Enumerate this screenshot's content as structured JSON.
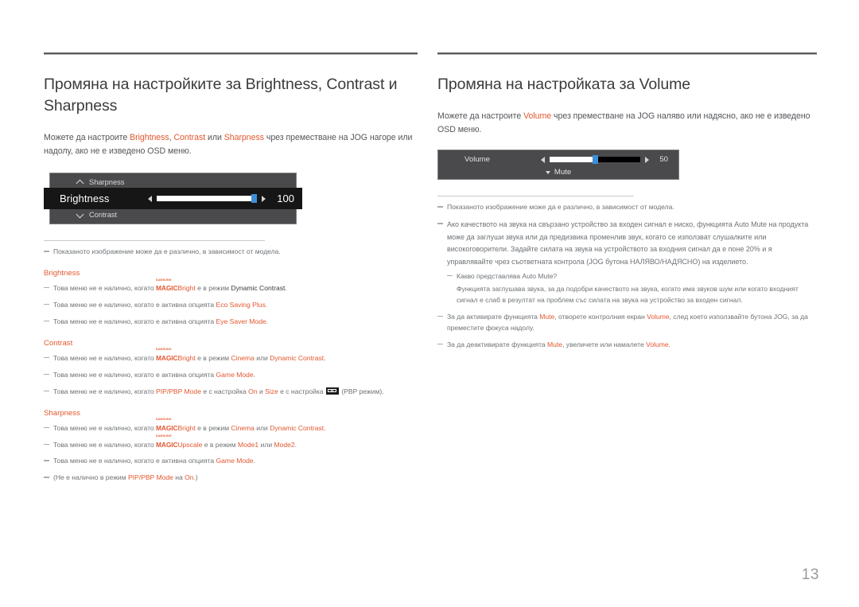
{
  "page": {
    "number": "13",
    "accent_color": "#e3582f",
    "title_color": "#3b3b3b",
    "body_color": "#54565a",
    "note_color": "#6e7276"
  },
  "left": {
    "title": "Промяна на настройките за Brightness, Contrast и Sharpness",
    "intro": {
      "p1": "Можете да настроите ",
      "a1": "Brightness",
      "p2": ", ",
      "a2": "Contrast",
      "p3": " или ",
      "a3": "Sharpness",
      "p4": " чрез преместване на JOG нагоре или надолу, ако не е изведено OSD меню."
    },
    "osd": {
      "row_top_label": "Sharpness",
      "row_top_icon": "chevron-up-icon",
      "selected_label": "Brightness",
      "selected_value": "100",
      "selected_fill_percent": 100,
      "row_bottom_label": "Contrast",
      "row_bottom_icon": "chevron-down-icon",
      "arrow_left_icon": "triangle-left-icon",
      "arrow_right_icon": "triangle-right-icon",
      "knob_color": "#3f8fd8"
    },
    "note_model": "Показаното изображение може да е различно, в зависимост от модела.",
    "sections": [
      {
        "heading": "Brightness",
        "notes": [
          {
            "pre": "Това меню не е налично, когато ",
            "magic_top": "SAMSUNG",
            "magic_main": "MAGIC",
            "magic_suffix": "Bright",
            "mid": " е в режим ",
            "accent_tail": "Dynamic Contrast",
            "post": "."
          },
          {
            "pre": "Това меню не е налично, когато е активна опцията ",
            "accent_tail": "Eco Saving Plus",
            "post": "."
          },
          {
            "pre": "Това меню не е налично, когато е активна опцията ",
            "accent_tail": "Eye Saver Mode",
            "post": "."
          }
        ]
      },
      {
        "heading": "Contrast",
        "notes": [
          {
            "pre": "Това меню не е налично, когато ",
            "magic_top": "SAMSUNG",
            "magic_main": "MAGIC",
            "magic_suffix": "Bright",
            "mid": " е в режим ",
            "accent_mid": "Cinema",
            "mid2": " или ",
            "accent_tail": "Dynamic Contrast",
            "post": "."
          },
          {
            "pre": "Това меню не е налично, когато е активна опцията ",
            "accent_tail": "Game Mode",
            "post": "."
          },
          {
            "pre": "Това меню не е налично, когато ",
            "accent_mid": "PIP/PBP Mode",
            "mid": " е с настройка ",
            "accent_mid2": "On",
            "mid2": " и ",
            "accent_mid3": "Size",
            "mid3": " е с настройка ",
            "icon": "pbp-mode-icon",
            "post": " (PBP режим)."
          }
        ]
      },
      {
        "heading": "Sharpness",
        "notes": [
          {
            "pre": "Това меню не е налично, когато ",
            "magic_top": "SAMSUNG",
            "magic_main": "MAGIC",
            "magic_suffix": "Bright",
            "mid": " е в режим ",
            "accent_mid": "Cinema",
            "mid2": " или ",
            "accent_tail": "Dynamic Contrast",
            "post": "."
          },
          {
            "pre": "Това меню не е налично, когато ",
            "magic_top": "SAMSUNG",
            "magic_main": "MAGIC",
            "magic_suffix": "Upscale",
            "mid": " е в режим ",
            "accent_mid": "Mode1",
            "mid2": " или ",
            "accent_tail": "Mode2",
            "post": "."
          },
          {
            "pre": "Това меню не е налично, когато е активна опцията ",
            "accent_tail": "Game Mode",
            "post": "."
          },
          {
            "pre": "(Не е налично в режим ",
            "accent_mid": "PIP/PBP Mode",
            "mid": " на ",
            "accent_tail": "On",
            "post": ".)"
          }
        ]
      }
    ]
  },
  "right": {
    "title": "Промяна на настройката за Volume",
    "intro": {
      "p1": "Можете да настроите ",
      "a1": "Volume",
      "p2": " чрез преместване на JOG наляво или надясно, ако не е изведено OSD меню."
    },
    "osd": {
      "label": "Volume",
      "value": "50",
      "fill_percent": 50,
      "mute_label": "Mute",
      "mute_icon": "chevron-down-icon",
      "arrow_left_icon": "triangle-left-icon",
      "arrow_right_icon": "triangle-right-icon",
      "knob_color": "#3f8fd8"
    },
    "note_model": "Показаното изображение може да е различно, в зависимост от модела.",
    "note_automute": "Ако качеството на звука на свързано устройство за входен сигнал е ниско, функцията Auto Mute на продукта може да заглуши звука или да предизвика променлив звук, когато се използват слушалките или високоговорители. Задайте силата на звука на устройството за входния сигнал да е поне 20% и я управлявайте чрез съответната контрола (JOG бутона НАЛЯВО/НАДЯСНО) на изделието.",
    "note_whatis": "Какво представлява Auto Mute?",
    "note_whatis_body": "Функцията заглушава звука, за да подобри качеството на звука, когато има звуков шум или когато входният сигнал е слаб в резултат на проблем със силата на звука на устройство за входен сигнал.",
    "note_activate": {
      "p1": "За да активирате функцията ",
      "a1": "Mute",
      "p2": ", отворете контролния екран ",
      "a2": "Volume",
      "p3": ", след което използвайте бутона JOG, за да преместите фокуса надолу."
    },
    "note_deactivate": {
      "p1": "За да деактивирате функцията ",
      "a1": "Mute",
      "p2": ", увеличете или намалете ",
      "a2": "Volume",
      "p3": "."
    }
  }
}
